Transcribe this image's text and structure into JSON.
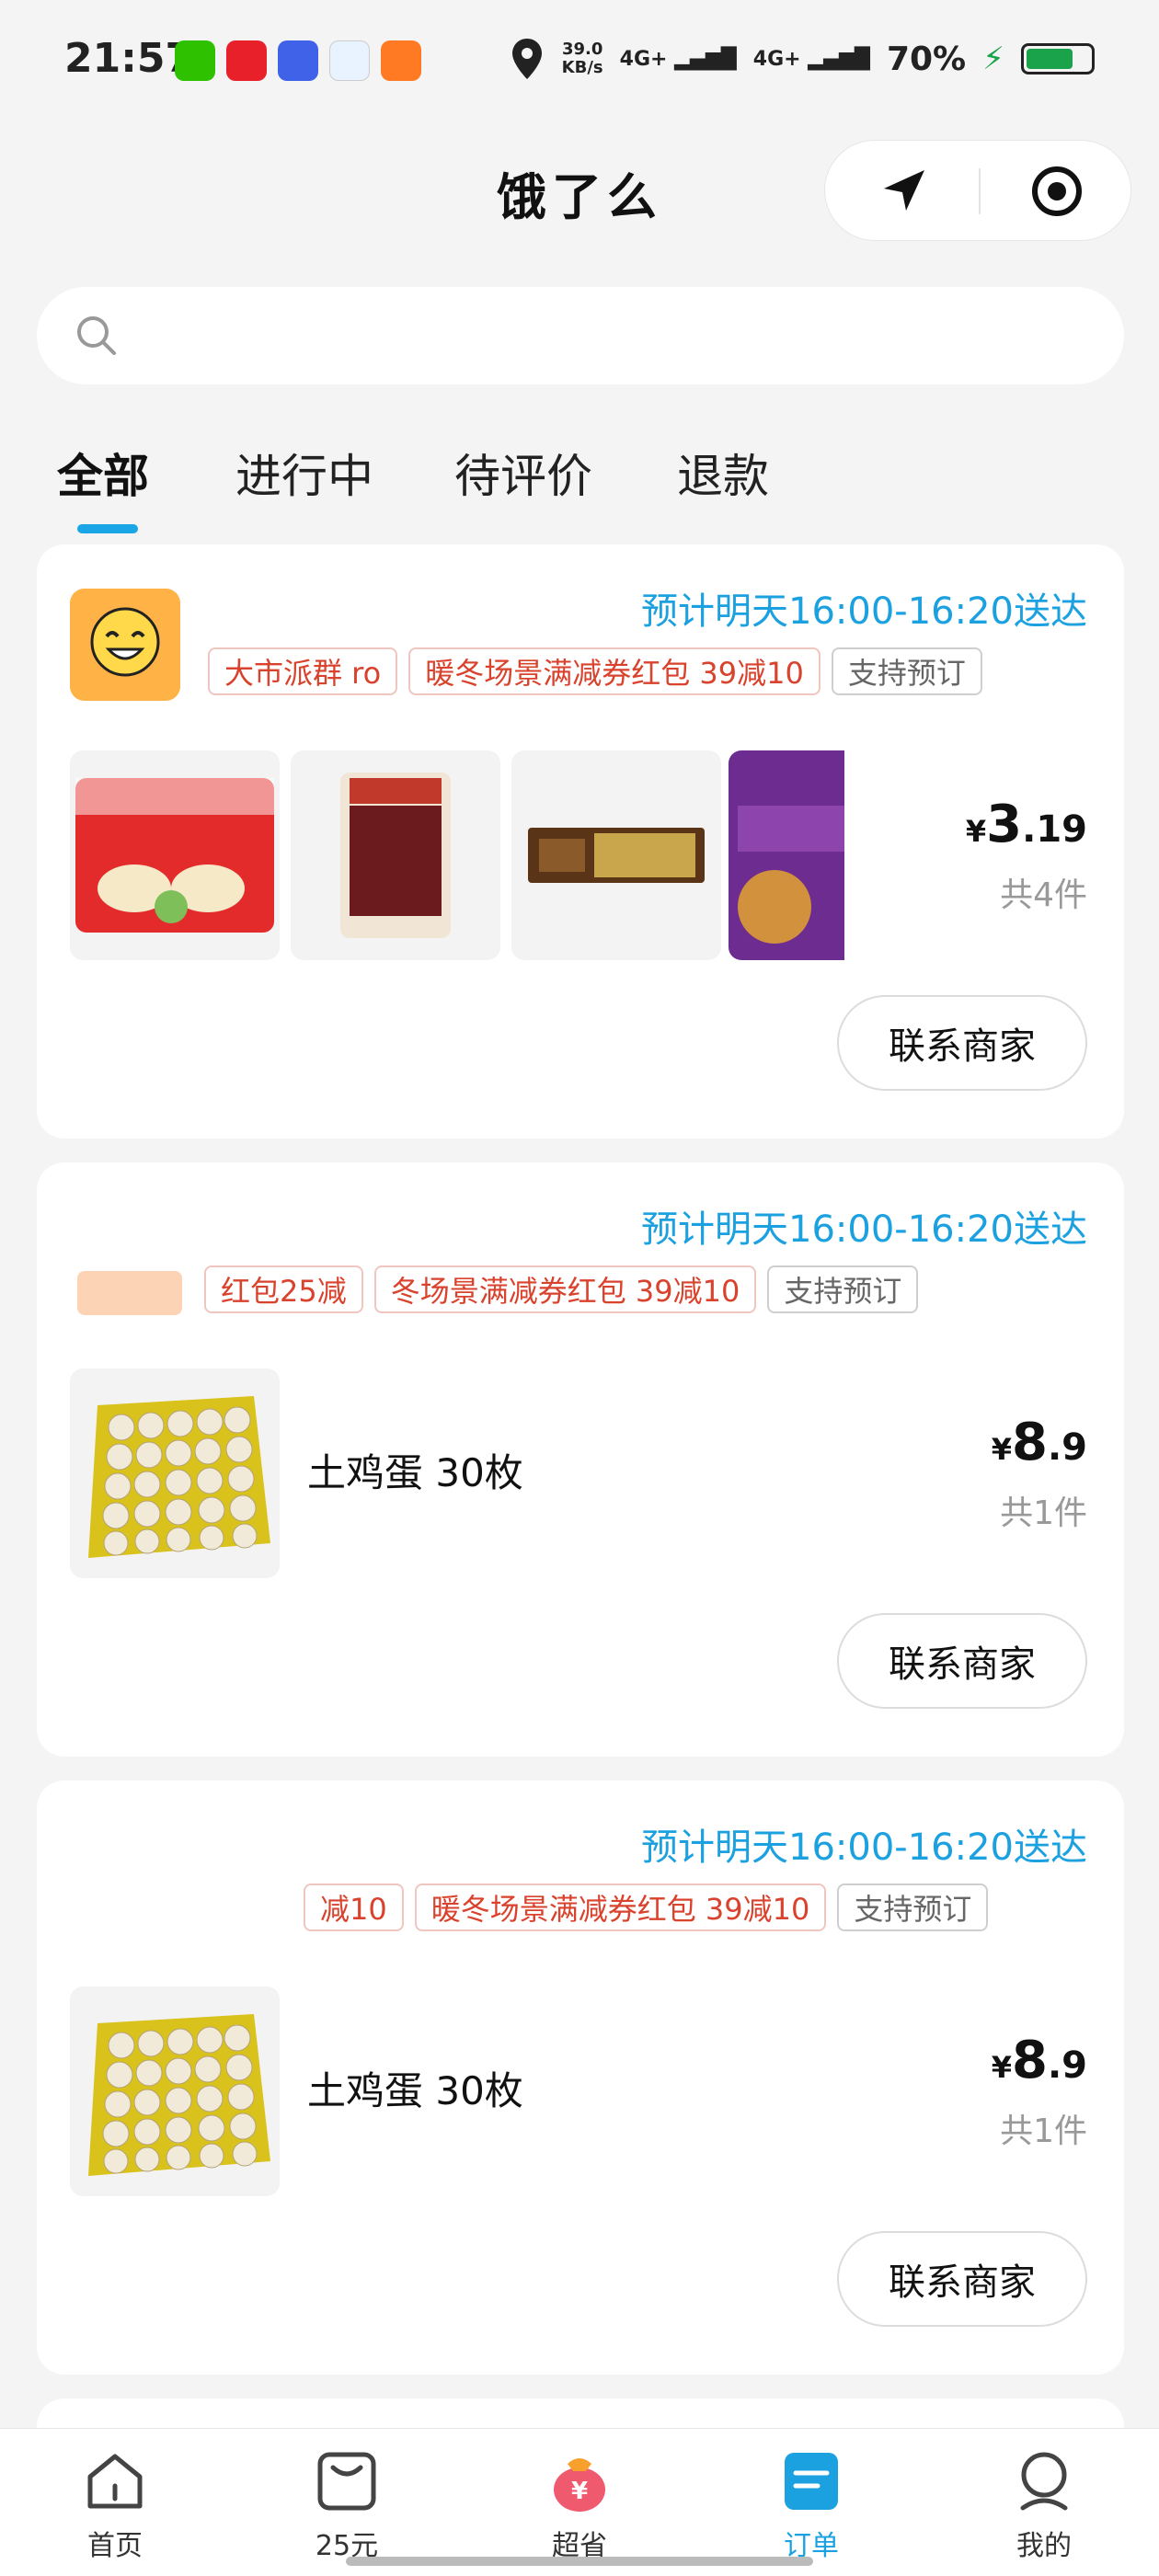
{
  "status_bar": {
    "time": "21:57",
    "speed_value": "39.0",
    "speed_unit": "KB/s",
    "net1": "4G+",
    "net2": "4G+",
    "battery_pct": "70%",
    "icons": [
      "wechat-icon",
      "app-red-icon",
      "app-blue-icon",
      "video-app-icon",
      "taobao-flash-icon",
      "location-icon",
      "signal-icon",
      "battery-icon"
    ]
  },
  "header": {
    "title": "饿了么"
  },
  "search": {
    "placeholder": ""
  },
  "tabs": [
    {
      "label": "全部",
      "active": true
    },
    {
      "label": "进行中",
      "active": false
    },
    {
      "label": "待评价",
      "active": false
    },
    {
      "label": "退款",
      "active": false
    }
  ],
  "orders": [
    {
      "delivery": "预计明天16:00-16:20送达",
      "tags": [
        "大市派群 ro",
        "暖冬场景满减券红包 39减10",
        "支持预订"
      ],
      "products": [
        "灌汤水饺",
        "手撕牦牛肉",
        "巧克力",
        "老坛酸菜牛肉面"
      ],
      "price_currency": "¥",
      "price_int": "3",
      "price_dec": ".19",
      "count": "共4件",
      "contact_label": "联系商家"
    },
    {
      "delivery": "预计明天16:00-16:20送达",
      "tags": [
        "红包25减",
        "冬场景满减券红包 39减10",
        "支持预订"
      ],
      "product_name": "土鸡蛋 30枚",
      "price_currency": "¥",
      "price_int": "8",
      "price_dec": ".9",
      "count": "共1件",
      "contact_label": "联系商家"
    },
    {
      "delivery": "预计明天16:00-16:20送达",
      "tags": [
        "减10",
        "暖冬场景满减券红包 39减10",
        "支持预订"
      ],
      "product_name": "土鸡蛋 30枚",
      "price_currency": "¥",
      "price_int": "8",
      "price_dec": ".9",
      "count": "共1件",
      "contact_label": "联系商家"
    }
  ],
  "bottom_nav": [
    {
      "label": "首页",
      "icon": "home-icon"
    },
    {
      "label": "25元",
      "icon": "coupon-icon"
    },
    {
      "label": "超省",
      "icon": "money-bag-icon"
    },
    {
      "label": "订单",
      "icon": "order-icon",
      "active": true
    },
    {
      "label": "我的",
      "icon": "profile-icon"
    }
  ],
  "colors": {
    "accent": "#1ba1e0",
    "tag_red": "#d9422c"
  }
}
